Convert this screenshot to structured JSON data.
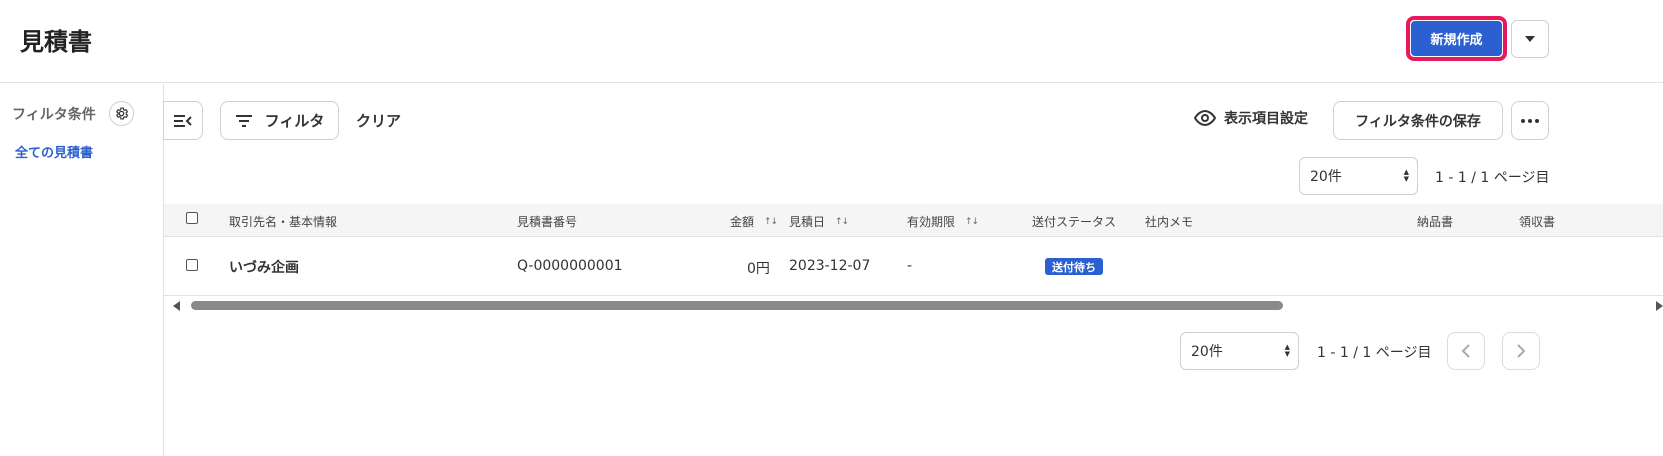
{
  "header": {
    "title": "見積書",
    "new_button": "新規作成"
  },
  "sidebar": {
    "title": "フィルタ条件",
    "all_link": "全ての見積書"
  },
  "toolbar": {
    "filter_label": "フィルタ",
    "clear_label": "クリア",
    "display_settings_label": "表示項目設定",
    "save_filter_label": "フィルタ条件の保存"
  },
  "pagination_top": {
    "per_page": "20件",
    "range_text": "1 - 1 / 1 ページ目"
  },
  "table": {
    "columns": [
      "取引先名・基本情報",
      "見積書番号",
      "金額",
      "見積日",
      "有効期限",
      "送付ステータス",
      "社内メモ",
      "納品書",
      "領収書"
    ],
    "rows": [
      {
        "client": "いづみ企画",
        "number": "Q-0000000001",
        "amount": "0円",
        "date": "2023-12-07",
        "expiry": "-",
        "status": "送付待ち",
        "memo": "",
        "delivery": "",
        "receipt": ""
      }
    ]
  },
  "pagination_bottom": {
    "per_page": "20件",
    "range_text": "1 - 1 / 1 ページ目"
  },
  "colors": {
    "primary": "#2c5fcf",
    "highlight_border": "#e8185c"
  }
}
